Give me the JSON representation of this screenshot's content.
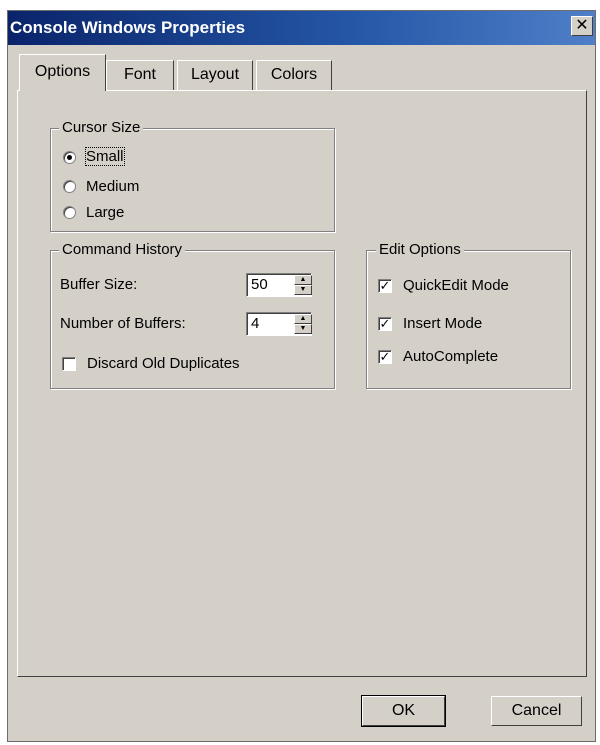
{
  "window": {
    "title": "Console Windows Properties",
    "close_glyph": "✕"
  },
  "tabs": [
    {
      "label": "Options",
      "active": true
    },
    {
      "label": "Font",
      "active": false
    },
    {
      "label": "Layout",
      "active": false
    },
    {
      "label": "Colors",
      "active": false
    }
  ],
  "cursor_size": {
    "legend": "Cursor Size",
    "options": [
      "Small",
      "Medium",
      "Large"
    ],
    "selected": "Small"
  },
  "command_history": {
    "legend": "Command History",
    "buffer_size_label": "Buffer Size:",
    "buffer_size_value": "50",
    "number_of_buffers_label": "Number of Buffers:",
    "number_of_buffers_value": "4",
    "discard_label": "Discard Old Duplicates",
    "discard_checked": false
  },
  "edit_options": {
    "legend": "Edit Options",
    "quickedit_label": "QuickEdit Mode",
    "insert_label": "Insert Mode",
    "autocomplete_label": "AutoComplete",
    "quickedit_checked": true,
    "insert_checked": true,
    "autocomplete_checked": true
  },
  "buttons": {
    "ok": "OK",
    "cancel": "Cancel"
  }
}
